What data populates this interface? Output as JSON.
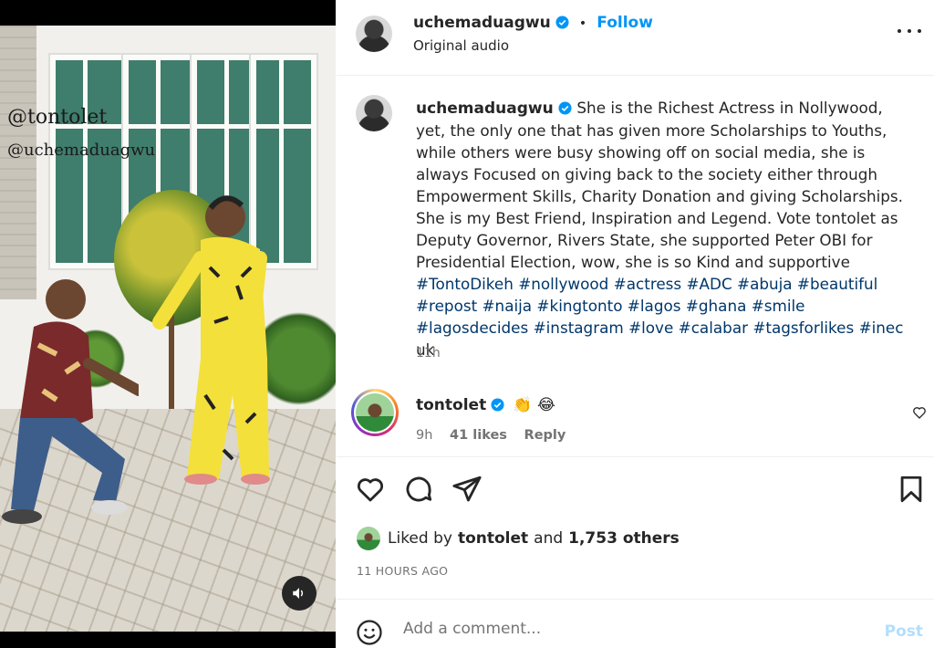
{
  "media": {
    "watermark_primary": "@tontolet",
    "watermark_secondary": "@uchemaduagwu",
    "mute_icon": "speaker-icon"
  },
  "header": {
    "username": "uchemaduagwu",
    "separator": "•",
    "follow_label": "Follow",
    "audio_label": "Original audio",
    "more_icon": "more-horizontal-icon"
  },
  "caption": {
    "username": "uchemaduagwu",
    "text": "She is the Richest Actress in Nollywood, yet, the only one that has given more Scholarships to Youths, while others were busy showing off on social media, she is always Focused on giving back to the society either through Empowerment Skills, Charity Donation and giving Scholarships. She is my Best Friend, Inspiration and Legend. Vote tontolet as Deputy Governor, Rivers State, she supported Peter OBI for Presidential Election, wow, she is so Kind and supportive",
    "hashtags": "#TontoDikeh #nollywood #actress #ADC #abuja #beautiful #repost #naija #kingtonto #lagos #ghana #smile #lagosdecides #instagram #love #calabar #tagsforlikes #inec",
    "suffix": " uk",
    "time": "11h"
  },
  "comment": {
    "username": "tontolet",
    "emojis": "👏 😂",
    "time": "9h",
    "likes": "41 likes",
    "reply_label": "Reply"
  },
  "likes": {
    "prefix": "Liked by",
    "liker": "tontolet",
    "middle": "and",
    "others": "1,753 others"
  },
  "date": "11 HOURS AGO",
  "add_comment": {
    "placeholder": "Add a comment...",
    "post_label": "Post"
  },
  "colors": {
    "accent": "#0095f6",
    "hashtag": "#00376b",
    "verified": "#0095f6",
    "post_disabled": "#b2dffc"
  }
}
